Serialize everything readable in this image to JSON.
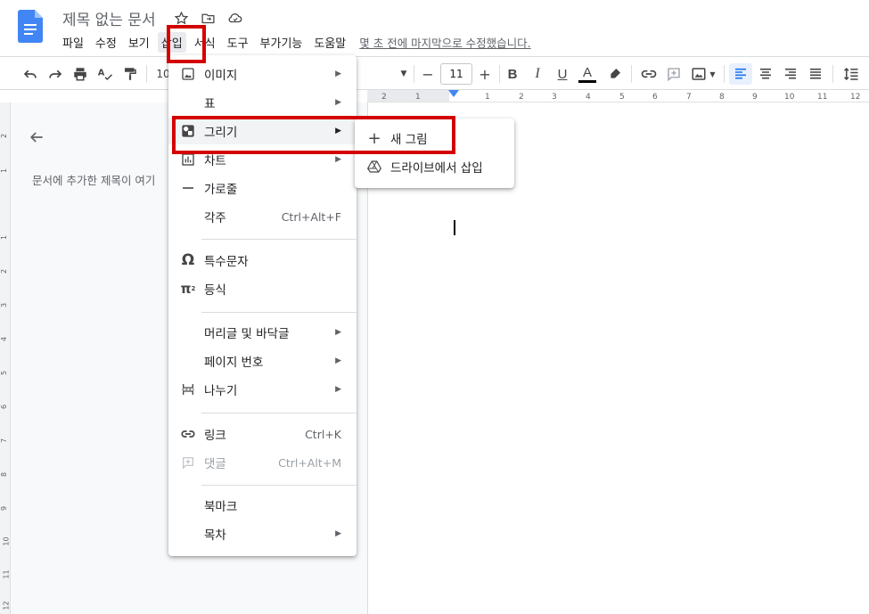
{
  "doc": {
    "title": "제목 없는 문서",
    "last_edit": "몇 초 전에 마지막으로 수정했습니다."
  },
  "menubar": [
    "파일",
    "수정",
    "보기",
    "삽입",
    "서식",
    "도구",
    "부가기능",
    "도움말"
  ],
  "toolbar": {
    "zoom_partial": "10",
    "font_size": "11",
    "minus": "−",
    "plus": "+"
  },
  "ruler_top": [
    "2",
    "1",
    "1",
    "2",
    "3",
    "4",
    "5",
    "6",
    "7",
    "8",
    "9",
    "10",
    "11",
    "12"
  ],
  "ruler_left": [
    "2",
    "1",
    "1",
    "2",
    "3",
    "4",
    "5",
    "6",
    "7",
    "8",
    "9",
    "10",
    "11",
    "12"
  ],
  "outline": {
    "hint": "문서에 추가한 제목이 여기"
  },
  "insert_menu": [
    {
      "label": "이미지",
      "icon": "image-icon",
      "arrow": true
    },
    {
      "label": "표",
      "icon": "",
      "arrow": true
    },
    {
      "label": "그리기",
      "icon": "drawing-icon",
      "arrow": true,
      "highlighted": true
    },
    {
      "label": "차트",
      "icon": "chart-icon",
      "arrow": true
    },
    {
      "label": "가로줄",
      "icon": "horizontal-line-icon",
      "arrow": false
    },
    {
      "label": "각주",
      "icon": "",
      "shortcut": "Ctrl+Alt+F"
    },
    {
      "label": "특수문자",
      "icon": "omega-icon",
      "arrow": false
    },
    {
      "label": "등식",
      "icon": "pi-icon",
      "arrow": false
    },
    {
      "label": "머리글 및 바닥글",
      "icon": "",
      "arrow": true
    },
    {
      "label": "페이지 번호",
      "icon": "",
      "arrow": true
    },
    {
      "label": "나누기",
      "icon": "page-break-icon",
      "arrow": true
    },
    {
      "label": "링크",
      "icon": "link-icon",
      "shortcut": "Ctrl+K"
    },
    {
      "label": "댓글",
      "icon": "comment-icon",
      "shortcut": "Ctrl+Alt+M",
      "disabled": true
    },
    {
      "label": "북마크",
      "icon": "",
      "arrow": false
    },
    {
      "label": "목차",
      "icon": "",
      "arrow": true
    }
  ],
  "drawing_submenu": [
    {
      "label": "새 그림",
      "icon": "plus-icon"
    },
    {
      "label": "드라이브에서 삽입",
      "icon": "drive-icon"
    }
  ],
  "colors": {
    "accent_blue": "#4285f4",
    "highlight_red": "#d40000",
    "text": "#202124",
    "muted": "#5f6368"
  }
}
